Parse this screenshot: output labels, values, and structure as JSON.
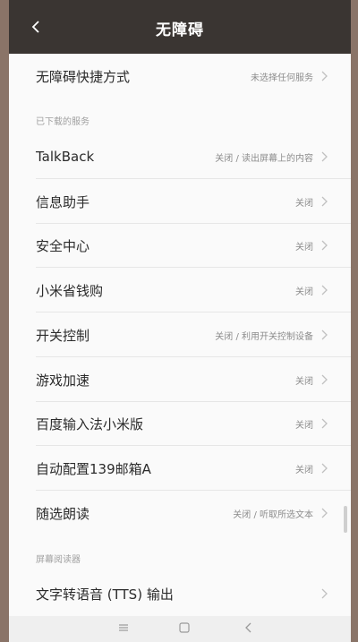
{
  "header": {
    "title": "无障碍",
    "back_icon": "chevron-left-icon"
  },
  "top_item": {
    "label": "无障碍快捷方式",
    "value": "未选择任何服务"
  },
  "sections": {
    "downloaded": "已下载的服务",
    "screen_reader": "屏幕阅读器"
  },
  "services": [
    {
      "label": "TalkBack",
      "value": "关闭 / 读出屏幕上的内容"
    },
    {
      "label": "信息助手",
      "value": "关闭"
    },
    {
      "label": "安全中心",
      "value": "关闭"
    },
    {
      "label": "小米省钱购",
      "value": "关闭"
    },
    {
      "label": "开关控制",
      "value": "关闭 / 利用开关控制设备"
    },
    {
      "label": "游戏加速",
      "value": "关闭"
    },
    {
      "label": "百度输入法小米版",
      "value": "关闭"
    },
    {
      "label": "自动配置139邮箱A",
      "value": "关闭"
    },
    {
      "label": "随选朗读",
      "value": "关闭 / 听取所选文本"
    }
  ],
  "reader_item": {
    "label": "文字转语音 (TTS) 输出"
  },
  "navbar": {
    "icons": [
      "menu-icon",
      "home-icon",
      "back-icon"
    ]
  }
}
